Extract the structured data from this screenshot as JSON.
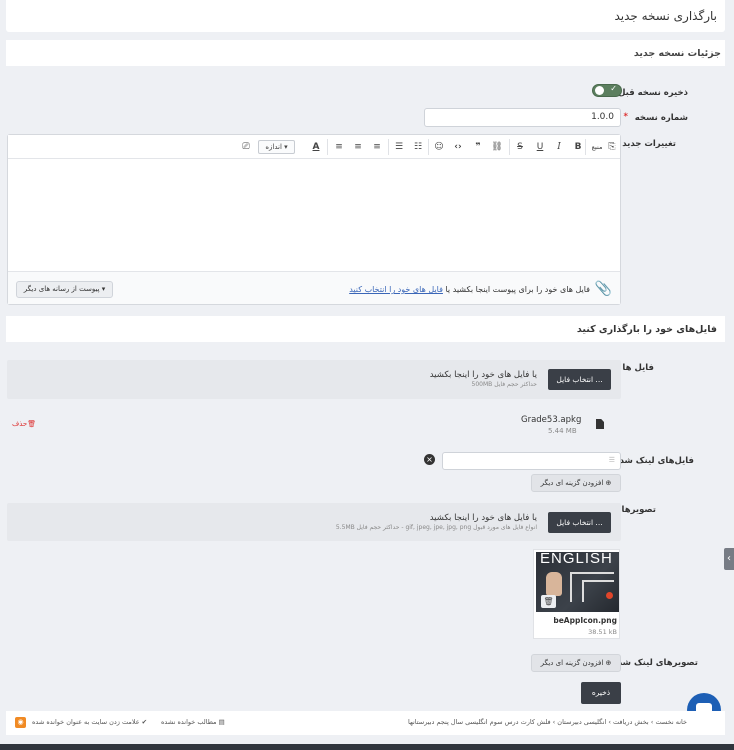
{
  "header": {
    "title": "بارگذاری نسخه جدید"
  },
  "details": {
    "section_title": "جزئیات نسخه جدید",
    "save_previous_label": "ذخیره نسخه قبل؟",
    "save_previous_on": true,
    "version_label": "شماره نسخه",
    "version_required_mark": "*",
    "version_value": "1.0.0",
    "changes_label": "تغییرات جدید"
  },
  "editor": {
    "toolbar": {
      "source_label": "منبع",
      "size_select": "اندازه",
      "buttons": [
        "source-icon",
        "bold-icon",
        "italic-icon",
        "underline-icon",
        "strikethrough-icon",
        "quote-icon",
        "code-icon",
        "link-icon",
        "emoji-icon",
        "ordered-list-icon",
        "unordered-list-icon",
        "align-left-icon",
        "align-center-icon",
        "align-right-icon",
        "font-color-icon",
        "clear-format-icon"
      ]
    },
    "attach_text": "فایل های خود را برای پیوست اینجا بکشید یا",
    "attach_link": "فایل های خود را انتخاب کنید",
    "media_button": "پیوست از رسانه های دیگر"
  },
  "upload": {
    "section_title": "فایل‌های خود را بارگذاری کنید",
    "files_label": "فایل ها",
    "files_select_button": "انتخاب فایل ...",
    "files_drop_text": "یا فایل های خود را اینجا بکشید",
    "files_max_text": "حداکثر حجم فایل 500MB",
    "file_item": {
      "name": "Grade53.apkg",
      "size": "5.44 MB",
      "delete_label": "حذف"
    },
    "linked_files_label": "فایل‌های لینک شده",
    "add_option_label": "افزودن گزینه ای دیگر",
    "images_label": "تصویرها",
    "images_select_button": "انتخاب فایل ...",
    "images_drop_text": "یا فایل های خود را اینجا بکشید",
    "images_types_text": "انواع فایل های مورد قبول gif, jpeg, jpe, jpg, png - حداکثر حجم فایل 5.5MB",
    "image_item": {
      "name": "beAppIcon.png",
      "size": "38.51 kB",
      "thumb_text": "ENGLISH"
    },
    "linked_images_label": "تصویرهای لینک شده",
    "save_button": "ذخیره"
  },
  "footer": {
    "breadcrumb": [
      "خانه نخست",
      "بخش دریافت",
      "انگلیسی دبیرستان",
      "فلش کارت درس سوم انگلیسی سال پنجم دبیرستانها"
    ],
    "unread": "مطالب خوانده نشده",
    "mark_read": "علامت زدن سایت به عنوان خوانده شده"
  },
  "colors": {
    "dark_button": "#3a3f47",
    "toggle_on": "#5c7f5f",
    "danger": "#dd3333",
    "link": "#3a66b8",
    "chat": "#1d5fb5",
    "rss": "#f08a24"
  }
}
